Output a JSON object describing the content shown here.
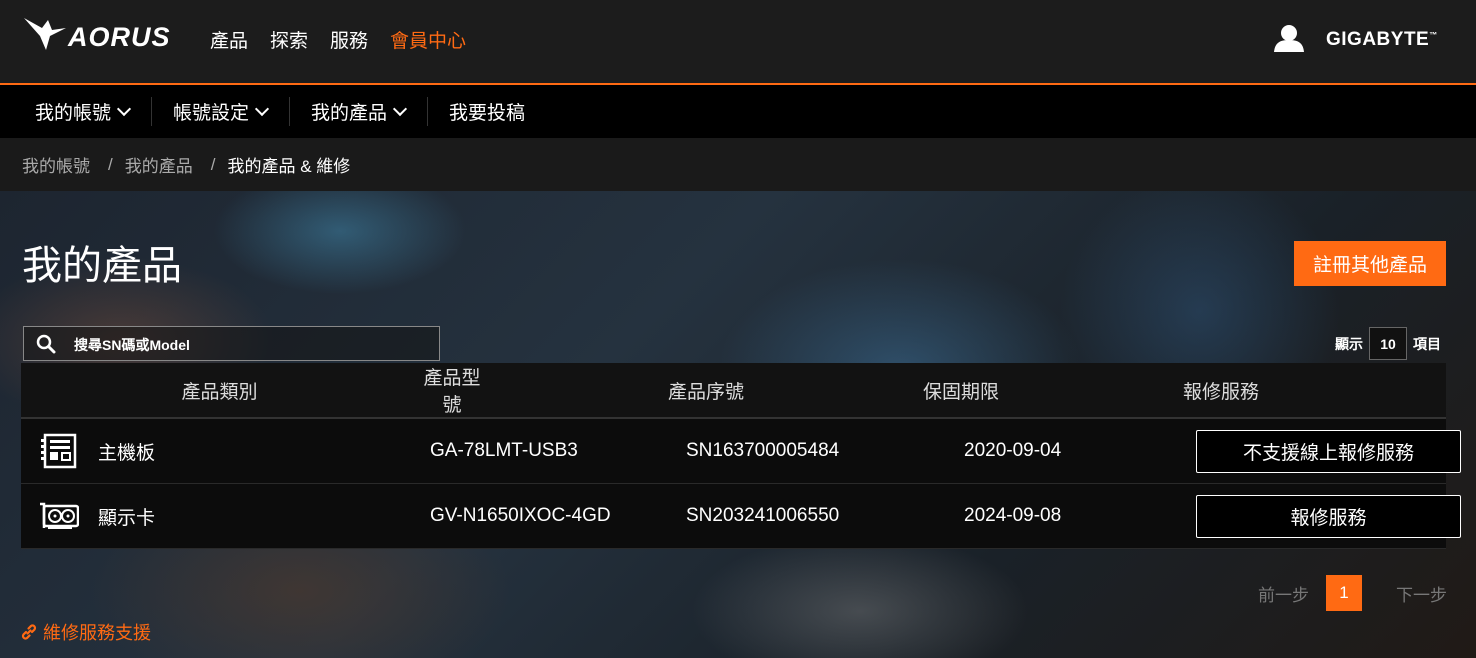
{
  "brand": {
    "logo": "AORUS",
    "corporate": "GIGABYTE"
  },
  "top_nav": [
    {
      "label": "產品"
    },
    {
      "label": "探索"
    },
    {
      "label": "服務"
    },
    {
      "label": "會員中心",
      "active": true
    }
  ],
  "sub_nav": [
    {
      "label": "我的帳號",
      "dropdown": true
    },
    {
      "label": "帳號設定",
      "dropdown": true
    },
    {
      "label": "我的產品",
      "dropdown": true
    },
    {
      "label": "我要投稿",
      "dropdown": false
    }
  ],
  "breadcrumb": [
    "我的帳號",
    "我的產品",
    "我的產品 & 維修"
  ],
  "page_title": "我的產品",
  "register_button": "註冊其他產品",
  "search": {
    "placeholder": "搜尋SN碼或Model"
  },
  "page_size": {
    "prefix": "顯示",
    "value": "10",
    "suffix": "項目"
  },
  "table": {
    "headers": [
      "產品類別",
      "產品型號",
      "產品序號",
      "保固期限",
      "報修服務"
    ],
    "rows": [
      {
        "icon": "motherboard-icon",
        "category": "主機板",
        "model": "GA-78LMT-USB3",
        "serial": "SN163700005484",
        "warranty": "2020-09-04",
        "service": "不支援線上報修服務"
      },
      {
        "icon": "graphics-card-icon",
        "category": "顯示卡",
        "model": "GV-N1650IXOC-4GD",
        "serial": "SN203241006550",
        "warranty": "2024-09-08",
        "service": "報修服務"
      }
    ]
  },
  "pagination": {
    "prev": "前一步",
    "current": "1",
    "next": "下一步"
  },
  "support_link": "維修服務支援",
  "colors": {
    "accent": "#ff6a13",
    "header_bg": "#1c1c1c",
    "row_bg": "#0c0c0c"
  }
}
